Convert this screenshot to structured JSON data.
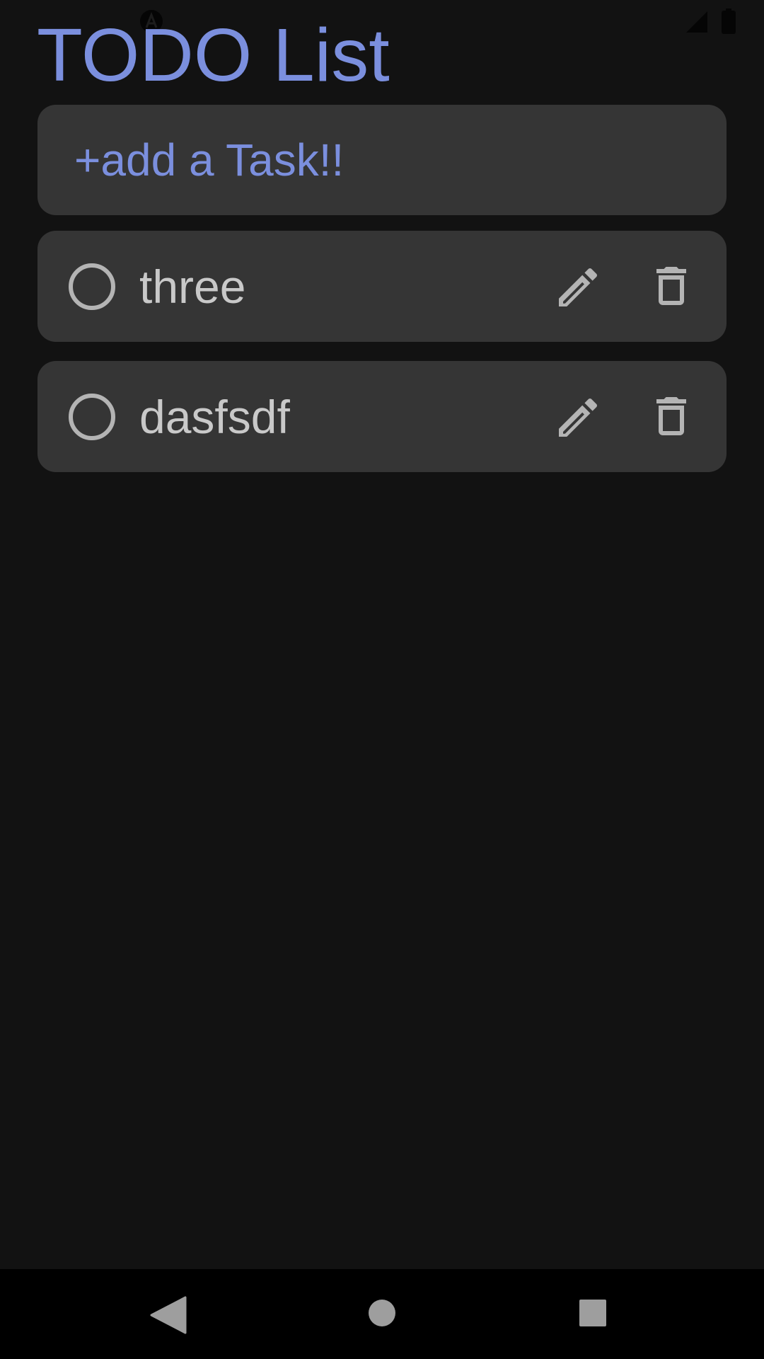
{
  "app": {
    "title": "TODO List"
  },
  "add_task": {
    "label": "+add a Task!!"
  },
  "tasks": [
    {
      "label": "three",
      "completed": false
    },
    {
      "label": "dasfsdf",
      "completed": false
    }
  ],
  "icons": {
    "status_left": "a-icon",
    "signal": "signal-icon",
    "battery": "battery-icon",
    "edit": "pencil-icon",
    "delete": "trash-icon",
    "checkbox": "circle-outline-icon",
    "nav_back": "back-triangle-icon",
    "nav_home": "home-circle-icon",
    "nav_recents": "recents-square-icon"
  },
  "colors": {
    "background": "#121212",
    "card": "#353535",
    "accent": "#7b8fde",
    "task_text": "#c9c9c9",
    "icon": "#b4b4b4",
    "nav_bar": "#000000",
    "nav_icon": "#9e9e9e"
  }
}
